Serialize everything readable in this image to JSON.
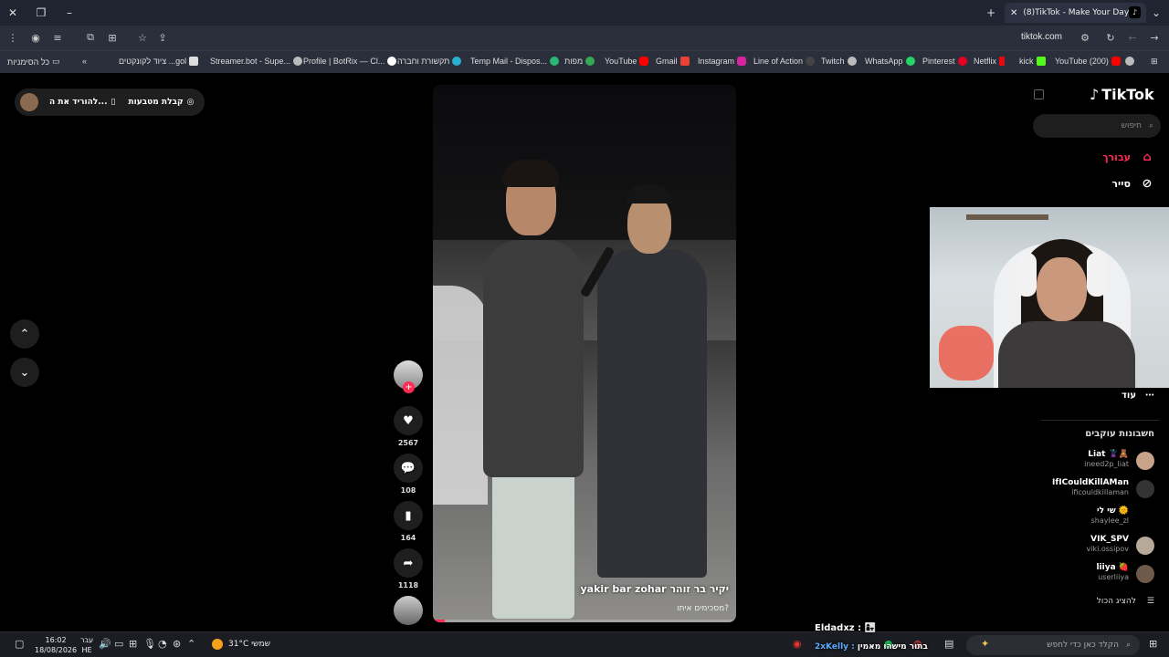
{
  "browser": {
    "tab_title": "(8)TikTok - Make Your Day",
    "url": "tiktok.com"
  },
  "bookmarks": [
    {
      "label": "YouTube (200)"
    },
    {
      "label": "kick"
    },
    {
      "label": "Netflix"
    },
    {
      "label": "Pinterest"
    },
    {
      "label": "WhatsApp"
    },
    {
      "label": "Twitch"
    },
    {
      "label": "Line of Action"
    },
    {
      "label": "Instagram"
    },
    {
      "label": "Gmail"
    },
    {
      "label": "YouTube"
    },
    {
      "label": "מפות"
    },
    {
      "label": "Temp Mail - Dispos..."
    },
    {
      "label": "תקשורת וחברה"
    },
    {
      "label": "Profile | BotRix — Cl..."
    },
    {
      "label": "Streamer.bot - Supe..."
    },
    {
      "label": "ציוד לקונקטים ...gol"
    }
  ],
  "bookmarks_all": "כל הסימניות",
  "promo": {
    "coins": "קבלת מטבעות",
    "download": "להוריד את ה..."
  },
  "video": {
    "username": "yakir bar zohar יקיר בר זוהר",
    "description": "מסכימים איתו?",
    "progress": 0.04
  },
  "actions": {
    "likes": "2567",
    "comments": "108",
    "saves": "164",
    "shares": "1118"
  },
  "sidebar": {
    "logo": "TikTok",
    "search_placeholder": "חיפוש",
    "for_you": "עבורך",
    "explore": "סייר",
    "more": "עוד",
    "following_title": "חשבונות עוקבים",
    "accounts": [
      {
        "name": "Liat 🦹‍♀️🧸",
        "handle": "ineed2p_liat"
      },
      {
        "name": "IfICouldKillAMan",
        "handle": "ificouldkillaman"
      },
      {
        "name": "שי לי 🌞",
        "handle": "shaylee_zl"
      },
      {
        "name": "VIK_SPV",
        "handle": "viki.ossipov"
      },
      {
        "name": "liiya 🍓",
        "handle": "userliiya"
      }
    ],
    "show_all": "להציג הכול"
  },
  "colors": {
    "accent": "#fe2c55"
  },
  "taskbar": {
    "time": "16:02",
    "date": "18/08/2026",
    "lang_top": "עבר",
    "lang_bottom": "HE",
    "weather": "31°C שמשי",
    "search_placeholder": "הקלד כאן כדי לחפש",
    "chat_user1": "Eldadxz :",
    "chat_line2_user": "2xKelly :",
    "chat_line2_text": "בתור מישהו מאמין"
  }
}
